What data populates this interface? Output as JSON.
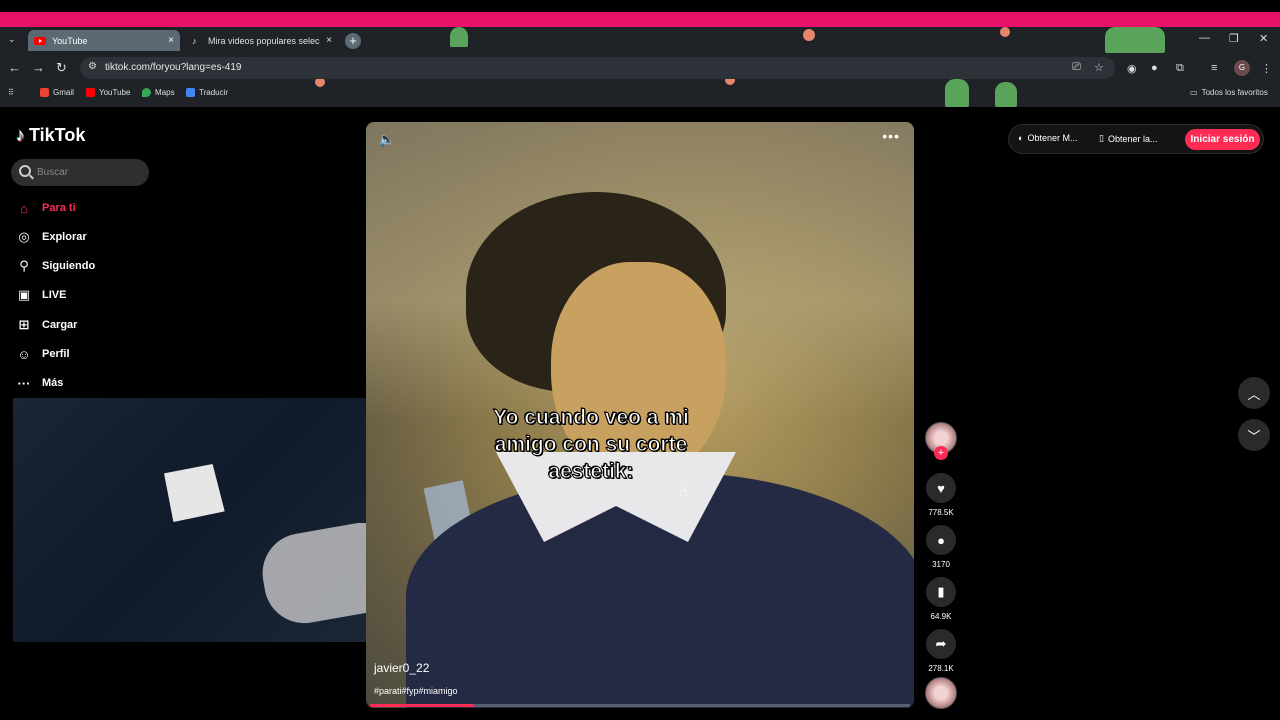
{
  "browser": {
    "tabs": [
      {
        "title": "YouTube",
        "active": true
      },
      {
        "title": "Mira videos populares seleccion",
        "active": false
      }
    ],
    "url": "tiktok.com/foryou?lang=es-419",
    "bookmarks": [
      "Gmail",
      "YouTube",
      "Maps",
      "Traducir"
    ],
    "all_bookmarks_label": "Todos los favoritos",
    "new_tab_symbol": "+",
    "close_symbol": "×",
    "profile_initial": "G"
  },
  "sidebar": {
    "logo": "TikTok",
    "search_placeholder": "Buscar",
    "items": [
      {
        "label": "Para ti",
        "icon": "home-icon"
      },
      {
        "label": "Explorar",
        "icon": "compass-icon"
      },
      {
        "label": "Siguiendo",
        "icon": "following-icon"
      },
      {
        "label": "LIVE",
        "icon": "live-icon"
      },
      {
        "label": "Cargar",
        "icon": "upload-icon"
      },
      {
        "label": "Perfil",
        "icon": "profile-icon"
      },
      {
        "label": "Más",
        "icon": "more-icon"
      }
    ]
  },
  "video": {
    "caption": "Yo cuando veo a mi amigo con su corte aestetik:",
    "author": "javier0_22",
    "hashtags": "#parati#fyp#miamigo",
    "progress": 0.19
  },
  "actions": {
    "likes": "778.5K",
    "comments": "3170",
    "saves": "64.9K",
    "shares": "278.1K"
  },
  "header_right": {
    "item1": "Obtener M...",
    "item2": "Obtener la...",
    "login": "Iniciar sesión"
  },
  "colors": {
    "accent": "#fe2c55",
    "browser_stripe": "#e8116a"
  }
}
